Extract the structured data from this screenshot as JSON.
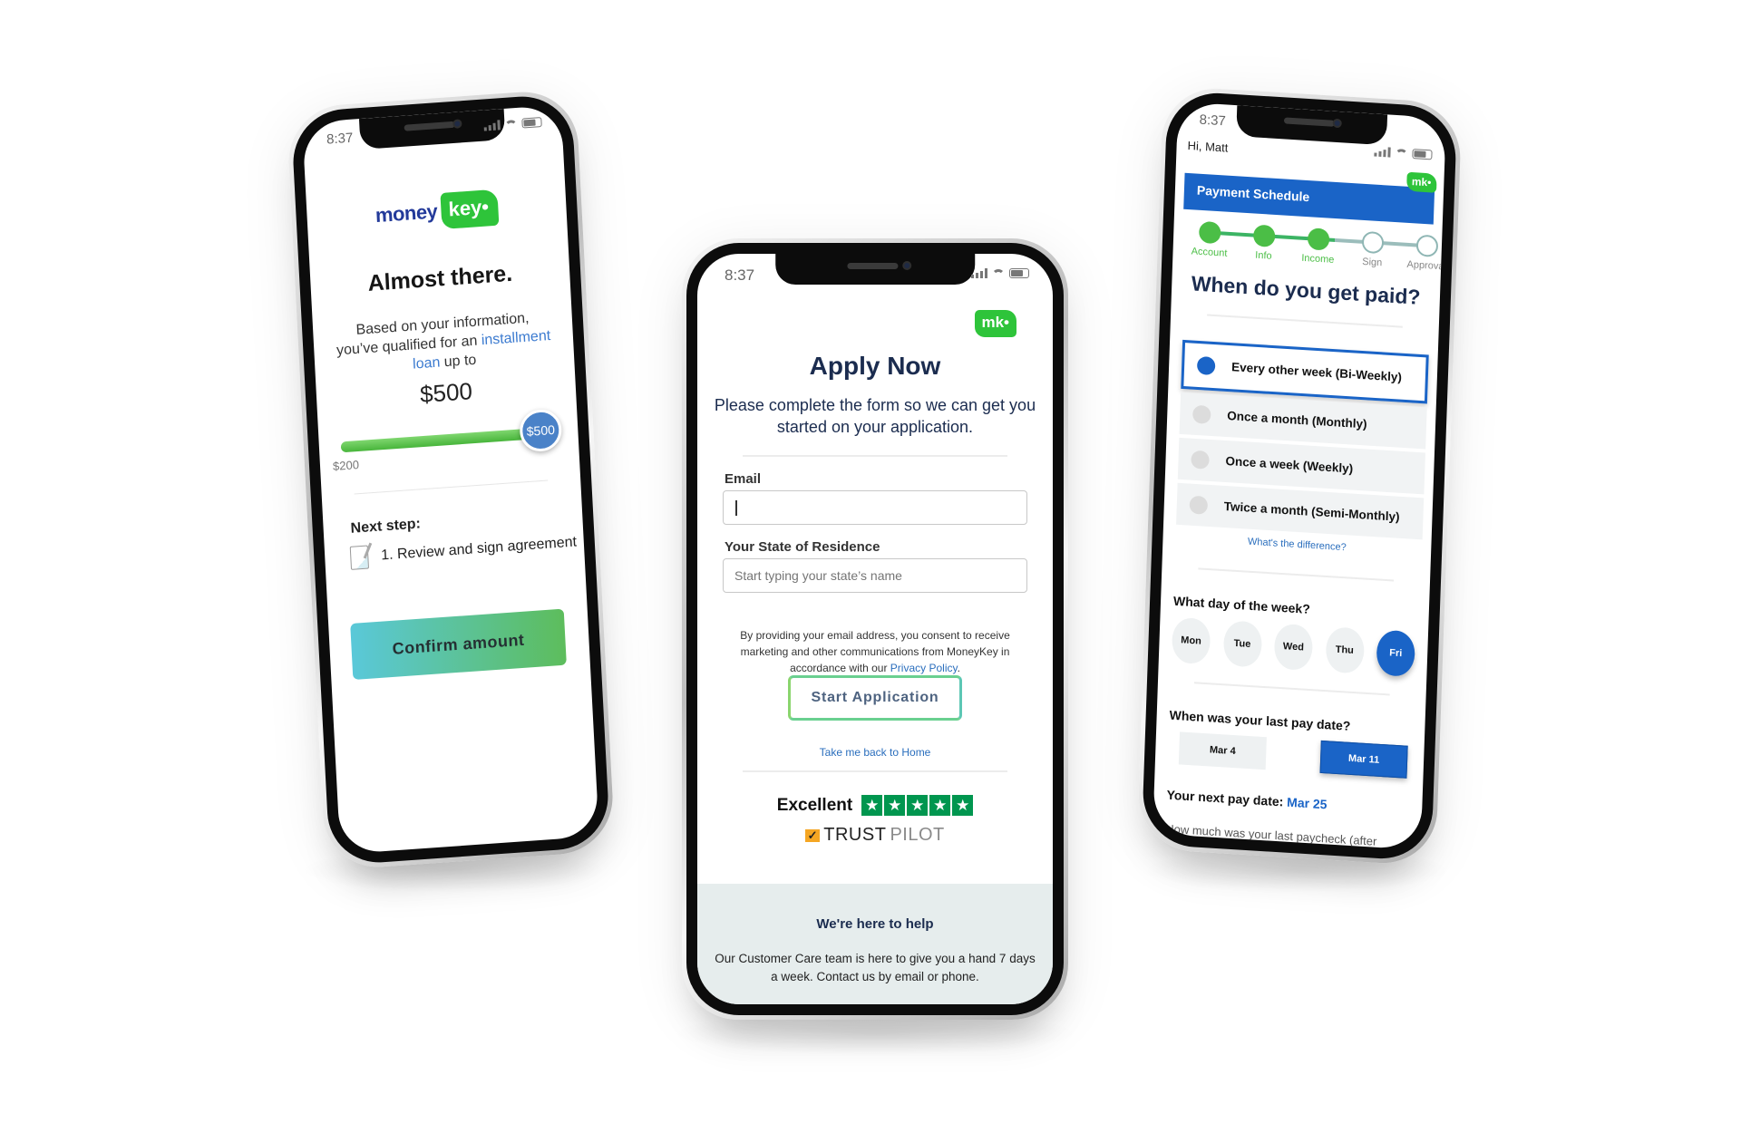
{
  "status_bar": {
    "time": "8:37"
  },
  "brand": {
    "word": "money",
    "badge": "key",
    "short": "mk"
  },
  "phone_left": {
    "title": "Almost there.",
    "desc_before": "Based on your information, you’ve qualified for an ",
    "desc_link": "installment loan",
    "desc_after": " up to",
    "amount": "$500",
    "slider": {
      "min_label": "$200",
      "thumb_label": "$500",
      "value": 500,
      "min": 200,
      "max": 500
    },
    "next_step_label": "Next step:",
    "step_item": "1. Review and sign agreement",
    "confirm_button": "Confirm amount"
  },
  "phone_mid": {
    "title": "Apply Now",
    "subtitle": "Please complete the form so we can get you started on your application.",
    "email_label": "Email",
    "email_value": "",
    "state_label": "Your State of Residence",
    "state_placeholder": "Start typing your state’s name",
    "legal_text": "By providing your email address, you consent to receive marketing and other communications from MoneyKey in accordance with our ",
    "legal_link": "Privacy Policy",
    "legal_end": ".",
    "start_button": "Start Application",
    "home_link": "Take me back to Home",
    "rating_label": "Excellent",
    "rating_stars": 5,
    "trust_a": "TRUST",
    "trust_b": "PILOT",
    "help_title": "We're here to help",
    "help_text": "Our Customer Care team is here to give you a hand 7 days a week. Contact us by email or phone."
  },
  "phone_right": {
    "greeting": "Hi, Matt",
    "section_title": "Payment Schedule",
    "steps": [
      {
        "label": "Account",
        "done": true
      },
      {
        "label": "Info",
        "done": true
      },
      {
        "label": "Income",
        "done": true
      },
      {
        "label": "Sign",
        "done": false
      },
      {
        "label": "Approval",
        "done": false
      }
    ],
    "question": "When do you get paid?",
    "frequency_options": [
      {
        "label": "Every other week (Bi-Weekly)",
        "selected": true
      },
      {
        "label": "Once a month (Monthly)",
        "selected": false
      },
      {
        "label": "Once a week (Weekly)",
        "selected": false
      },
      {
        "label": "Twice a month (Semi-Monthly)",
        "selected": false
      }
    ],
    "difference_link": "What's the difference?",
    "day_question": "What day of the week?",
    "days": [
      {
        "label": "Mon",
        "selected": false
      },
      {
        "label": "Tue",
        "selected": false
      },
      {
        "label": "Wed",
        "selected": false
      },
      {
        "label": "Thu",
        "selected": false
      },
      {
        "label": "Fri",
        "selected": true
      }
    ],
    "last_pay_question": "When was your last pay date?",
    "dates": [
      {
        "label": "Mar 4",
        "selected": false
      },
      {
        "label": "Mar 11",
        "selected": true
      }
    ],
    "next_pay_label": "Your next pay date: ",
    "next_pay_value": "Mar 25",
    "paycheck_question": "How much was your last paycheck (after"
  },
  "colors": {
    "brand_green": "#2ec43a",
    "brand_blue": "#1a64c7",
    "navy": "#1b2c4f",
    "link": "#2a6ebd",
    "trustpilot_green": "#00964f"
  }
}
